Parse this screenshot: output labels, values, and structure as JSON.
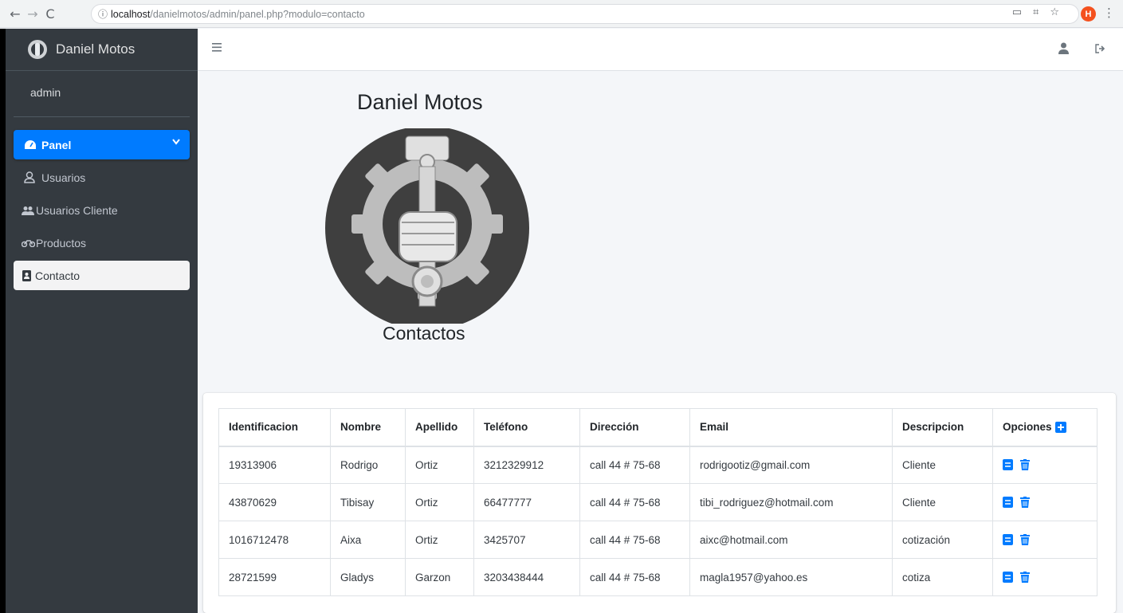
{
  "browser": {
    "url_host": "localhost",
    "url_path": "/danielmotos/admin/panel.php?modulo=contacto",
    "profile_initial": "H"
  },
  "sidebar": {
    "brand": "Daniel Motos",
    "user": "admin",
    "items": [
      {
        "label": "Panel",
        "icon": "tachometer-icon"
      },
      {
        "label": "Usuarios",
        "icon": "user-icon"
      },
      {
        "label": "Usuarios Cliente",
        "icon": "users-icon"
      },
      {
        "label": "Productos",
        "icon": "motorcycle-icon"
      },
      {
        "label": "Contacto",
        "icon": "address-book-icon"
      }
    ]
  },
  "main": {
    "title": "Daniel Motos",
    "subtitle": "Contactos"
  },
  "table": {
    "headers": [
      "Identificacion",
      "Nombre",
      "Apellido",
      "Teléfono",
      "Dirección",
      "Email",
      "Descripcion",
      "Opciones"
    ],
    "rows": [
      [
        "19313906",
        "Rodrigo",
        "Ortiz",
        "3212329912",
        "call 44 # 75-68",
        "rodrigootiz@gmail.com",
        "Cliente"
      ],
      [
        "43870629",
        "Tibisay",
        "Ortiz",
        "66477777",
        "call 44 # 75-68",
        "tibi_rodriguez@hotmail.com",
        "Cliente"
      ],
      [
        "1016712478",
        "Aixa",
        "Ortiz",
        "3425707",
        "call 44 # 75-68",
        "aixc@hotmail.com",
        "cotización"
      ],
      [
        "28721599",
        "Gladys",
        "Garzon",
        "3203438444",
        "call 44 # 75-68",
        "magla1957@yahoo.es",
        "cotiza"
      ]
    ]
  },
  "colors": {
    "sidebar_bg": "#343a40",
    "accent": "#007bff",
    "content_bg": "#f4f6f9"
  }
}
